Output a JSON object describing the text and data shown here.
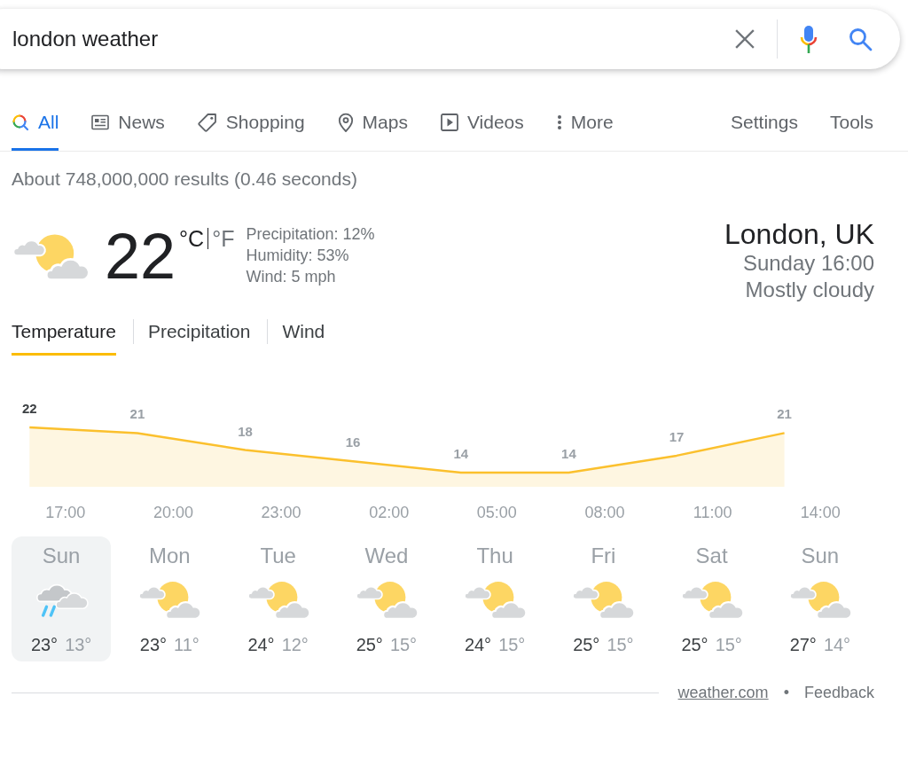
{
  "search": {
    "value": "london weather"
  },
  "tabs": [
    {
      "label": "All",
      "kind": "all",
      "selected": true
    },
    {
      "label": "News",
      "kind": "news",
      "selected": false
    },
    {
      "label": "Shopping",
      "kind": "shopping",
      "selected": false
    },
    {
      "label": "Maps",
      "kind": "maps",
      "selected": false
    },
    {
      "label": "Videos",
      "kind": "videos",
      "selected": false
    },
    {
      "label": "More",
      "kind": "more",
      "selected": false
    }
  ],
  "tools_links": [
    "Settings",
    "Tools"
  ],
  "result_stats": "About 748,000,000 results (0.46 seconds)",
  "weather": {
    "temperature": "22",
    "units": [
      {
        "label": "°C",
        "selected": true
      },
      {
        "label": "°F",
        "selected": false
      }
    ],
    "details": [
      "Precipitation: 12%",
      "Humidity: 53%",
      "Wind: 5 mph"
    ],
    "location": "London, UK",
    "time": "Sunday 16:00",
    "condition": "Mostly cloudy"
  },
  "view_tabs": [
    {
      "label": "Temperature",
      "selected": true
    },
    {
      "label": "Precipitation",
      "selected": false
    },
    {
      "label": "Wind",
      "selected": false
    }
  ],
  "hourly": {
    "chart_data": {
      "type": "area",
      "categories": [
        null,
        "17:00",
        null,
        null,
        "20:00",
        null,
        null,
        "23:00",
        null,
        null,
        "02:00",
        null,
        null,
        "05:00",
        null,
        null,
        "08:00",
        null,
        null,
        "11:00",
        null,
        null,
        "14:00",
        null
      ],
      "series": [
        {
          "color": "#fbc02d",
          "values": [
            22,
            null,
            null,
            21,
            null,
            null,
            18,
            null,
            null,
            16,
            null,
            null,
            14,
            null,
            null,
            14,
            null,
            null,
            17,
            null,
            null,
            21,
            null,
            null
          ]
        }
      ],
      "data_labels": true
    }
  },
  "days": [
    {
      "day": "Sun",
      "kind": "rain",
      "high": "23°",
      "low": "13°",
      "selected": true
    },
    {
      "day": "Mon",
      "kind": "partlycloudy",
      "high": "23°",
      "low": "11°",
      "selected": false
    },
    {
      "day": "Tue",
      "kind": "partlycloudy",
      "high": "24°",
      "low": "12°",
      "selected": false
    },
    {
      "day": "Wed",
      "kind": "partlycloudy",
      "high": "25°",
      "low": "15°",
      "selected": false
    },
    {
      "day": "Thu",
      "kind": "partlycloudy",
      "high": "24°",
      "low": "15°",
      "selected": false
    },
    {
      "day": "Fri",
      "kind": "partlycloudy",
      "high": "25°",
      "low": "15°",
      "selected": false
    },
    {
      "day": "Sat",
      "kind": "partlycloudy",
      "high": "25°",
      "low": "15°",
      "selected": false
    },
    {
      "day": "Sun",
      "kind": "partlycloudy",
      "high": "27°",
      "low": "14°",
      "selected": false
    }
  ],
  "footer": {
    "source": "weather.com",
    "separator": "•",
    "feedback": "Feedback"
  }
}
